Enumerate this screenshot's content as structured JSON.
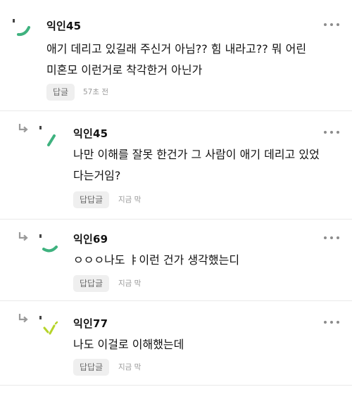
{
  "comments": [
    {
      "author": "익인45",
      "text_lines": [
        "애기 데리고 있길래 주신거 아님?? 힘 내라고?? 뭐 어린",
        "미혼모 이런거로 착각한거 아닌가"
      ],
      "reply_label": "답글",
      "time": "57초 전",
      "is_reply": false,
      "avatar_icon": "green-swoosh-avatar-icon"
    },
    {
      "author": "익인45",
      "text_lines": [
        "나만 이해를 잘못 한건가 그 사람이 애기 데리고 있었",
        "다는거임?"
      ],
      "reply_label": "답답글",
      "time": "지금 막",
      "is_reply": true,
      "avatar_icon": "green-slash-avatar-icon"
    },
    {
      "author": "익인69",
      "text_lines": [
        "ㅇㅇㅇ나도 ㅑ이런 건가 생각했는디"
      ],
      "reply_label": "답답글",
      "time": "지금 막",
      "is_reply": true,
      "avatar_icon": "green-swoosh-avatar-icon"
    },
    {
      "author": "익인77",
      "text_lines": [
        "나도 이걸로 이해했는데"
      ],
      "reply_label": "답답글",
      "time": "지금 막",
      "is_reply": true,
      "avatar_icon": "yellow-green-sparkle-avatar-icon"
    }
  ],
  "colors": {
    "avatar_green": "#3fb27f",
    "avatar_lime": "#b6d42a",
    "reply_arrow": "#9a9a9a",
    "button_bg": "#efefef",
    "divider": "#e9e9e9"
  }
}
